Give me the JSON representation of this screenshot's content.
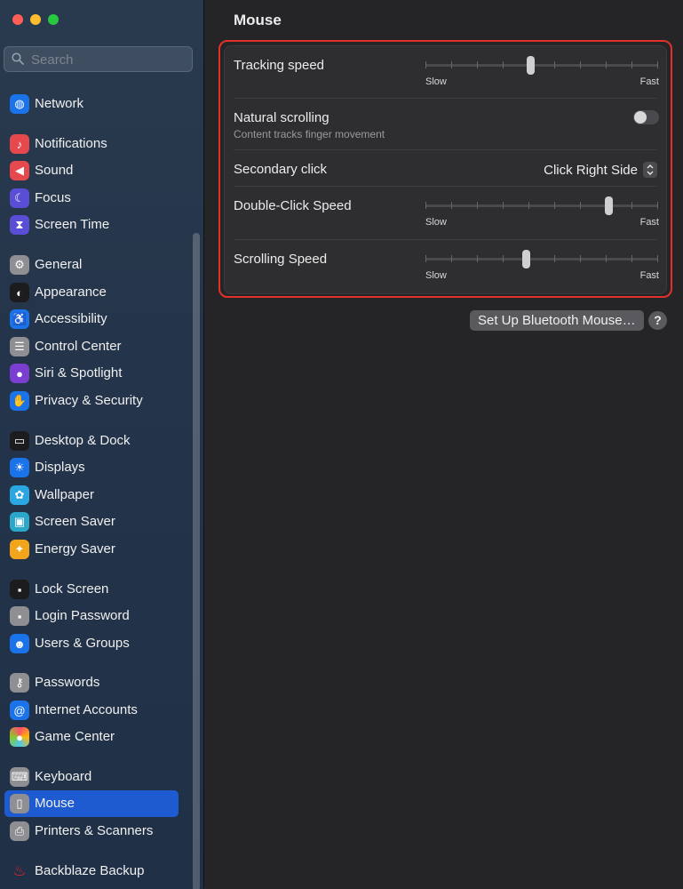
{
  "window": {
    "close_color": "#ff5f57",
    "minimize_color": "#febc2e",
    "zoom_color": "#28c840"
  },
  "search": {
    "placeholder": "Search"
  },
  "sidebar": {
    "items": [
      {
        "label": "Network",
        "icon": "globe-icon",
        "color": "#1a73e8"
      },
      {
        "label": "Notifications",
        "icon": "bell-icon",
        "color": "#e5484d"
      },
      {
        "label": "Sound",
        "icon": "speaker-icon",
        "color": "#e5484d"
      },
      {
        "label": "Focus",
        "icon": "moon-icon",
        "color": "#5b4ed6"
      },
      {
        "label": "Screen Time",
        "icon": "hourglass-icon",
        "color": "#5b4ed6"
      },
      {
        "label": "General",
        "icon": "gear-icon",
        "color": "#8e8e93"
      },
      {
        "label": "Appearance",
        "icon": "appearance-icon",
        "color": "#1c1c1e"
      },
      {
        "label": "Accessibility",
        "icon": "accessibility-icon",
        "color": "#1a73e8"
      },
      {
        "label": "Control Center",
        "icon": "control-center-icon",
        "color": "#8e8e93"
      },
      {
        "label": "Siri & Spotlight",
        "icon": "siri-icon",
        "color": "#7a3fd0"
      },
      {
        "label": "Privacy & Security",
        "icon": "hand-icon",
        "color": "#1a73e8"
      },
      {
        "label": "Desktop & Dock",
        "icon": "dock-icon",
        "color": "#1c1c1e"
      },
      {
        "label": "Displays",
        "icon": "sun-icon",
        "color": "#1a73e8"
      },
      {
        "label": "Wallpaper",
        "icon": "flower-icon",
        "color": "#2aa7e0"
      },
      {
        "label": "Screen Saver",
        "icon": "screen-saver-icon",
        "color": "#2aa7c9"
      },
      {
        "label": "Energy Saver",
        "icon": "lightbulb-icon",
        "color": "#f2a51a"
      },
      {
        "label": "Lock Screen",
        "icon": "lock-icon",
        "color": "#1c1c1e"
      },
      {
        "label": "Login Password",
        "icon": "padlock-icon",
        "color": "#8e8e93"
      },
      {
        "label": "Users & Groups",
        "icon": "users-icon",
        "color": "#1a73e8"
      },
      {
        "label": "Passwords",
        "icon": "key-icon",
        "color": "#8e8e93"
      },
      {
        "label": "Internet Accounts",
        "icon": "at-icon",
        "color": "#1a73e8"
      },
      {
        "label": "Game Center",
        "icon": "game-center-icon",
        "color": "#ffffff"
      },
      {
        "label": "Keyboard",
        "icon": "keyboard-icon",
        "color": "#8e8e93"
      },
      {
        "label": "Mouse",
        "icon": "mouse-icon",
        "color": "#8e8e93",
        "selected": true
      },
      {
        "label": "Printers & Scanners",
        "icon": "printer-icon",
        "color": "#8e8e93"
      },
      {
        "label": "Backblaze Backup",
        "icon": "flame-icon",
        "color": "#d7282f"
      }
    ]
  },
  "main": {
    "title": "Mouse",
    "tracking": {
      "label": "Tracking speed",
      "slow": "Slow",
      "fast": "Fast",
      "level": 0.45
    },
    "natural": {
      "label": "Natural scrolling",
      "sub": "Content tracks finger movement",
      "on": false
    },
    "secondary": {
      "label": "Secondary click",
      "value": "Click Right Side"
    },
    "double_click": {
      "label": "Double-Click Speed",
      "slow": "Slow",
      "fast": "Fast",
      "level": 0.8
    },
    "scrolling": {
      "label": "Scrolling Speed",
      "slow": "Slow",
      "fast": "Fast",
      "level": 0.43
    },
    "bluetooth_button": "Set Up Bluetooth Mouse…",
    "help": "?",
    "highlight_color": "#e1322a"
  }
}
